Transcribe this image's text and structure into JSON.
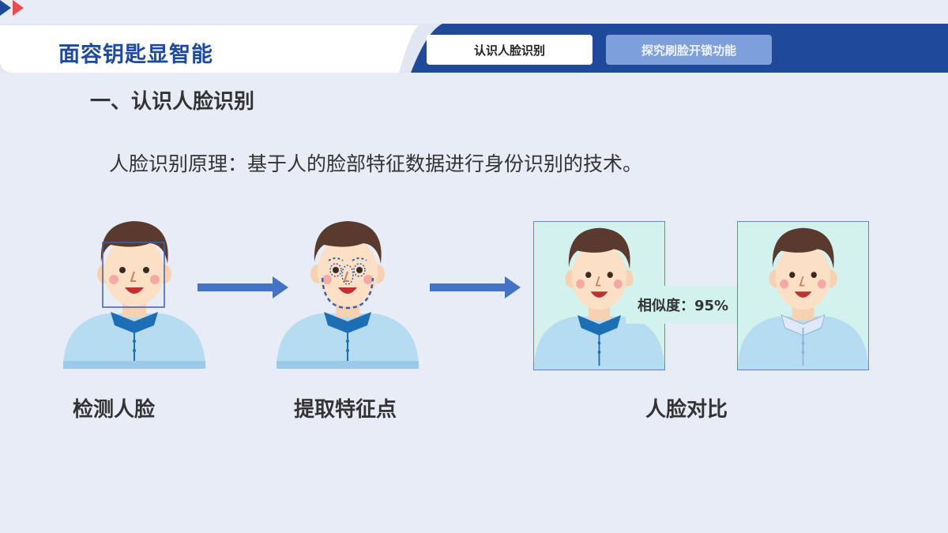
{
  "header": {
    "brand_title": "面容钥匙显智能",
    "tabs": [
      {
        "label": "认识人脸识别",
        "active": true
      },
      {
        "label": "探究刷脸开锁功能",
        "active": false
      }
    ]
  },
  "section": {
    "title": "一、认识人脸识别",
    "principle": "人脸识别原理：基于人的脸部特征数据进行身份识别的技术。"
  },
  "steps": [
    {
      "caption": "检测人脸"
    },
    {
      "caption": "提取特征点"
    },
    {
      "caption": "人脸对比"
    }
  ],
  "comparison": {
    "similarity_label": "相似度：95%"
  },
  "colors": {
    "brand_blue": "#1f4a9c",
    "accent_red": "#e84c4c",
    "arrow_blue": "#4472c4",
    "page_bg": "#e8ecf7"
  }
}
